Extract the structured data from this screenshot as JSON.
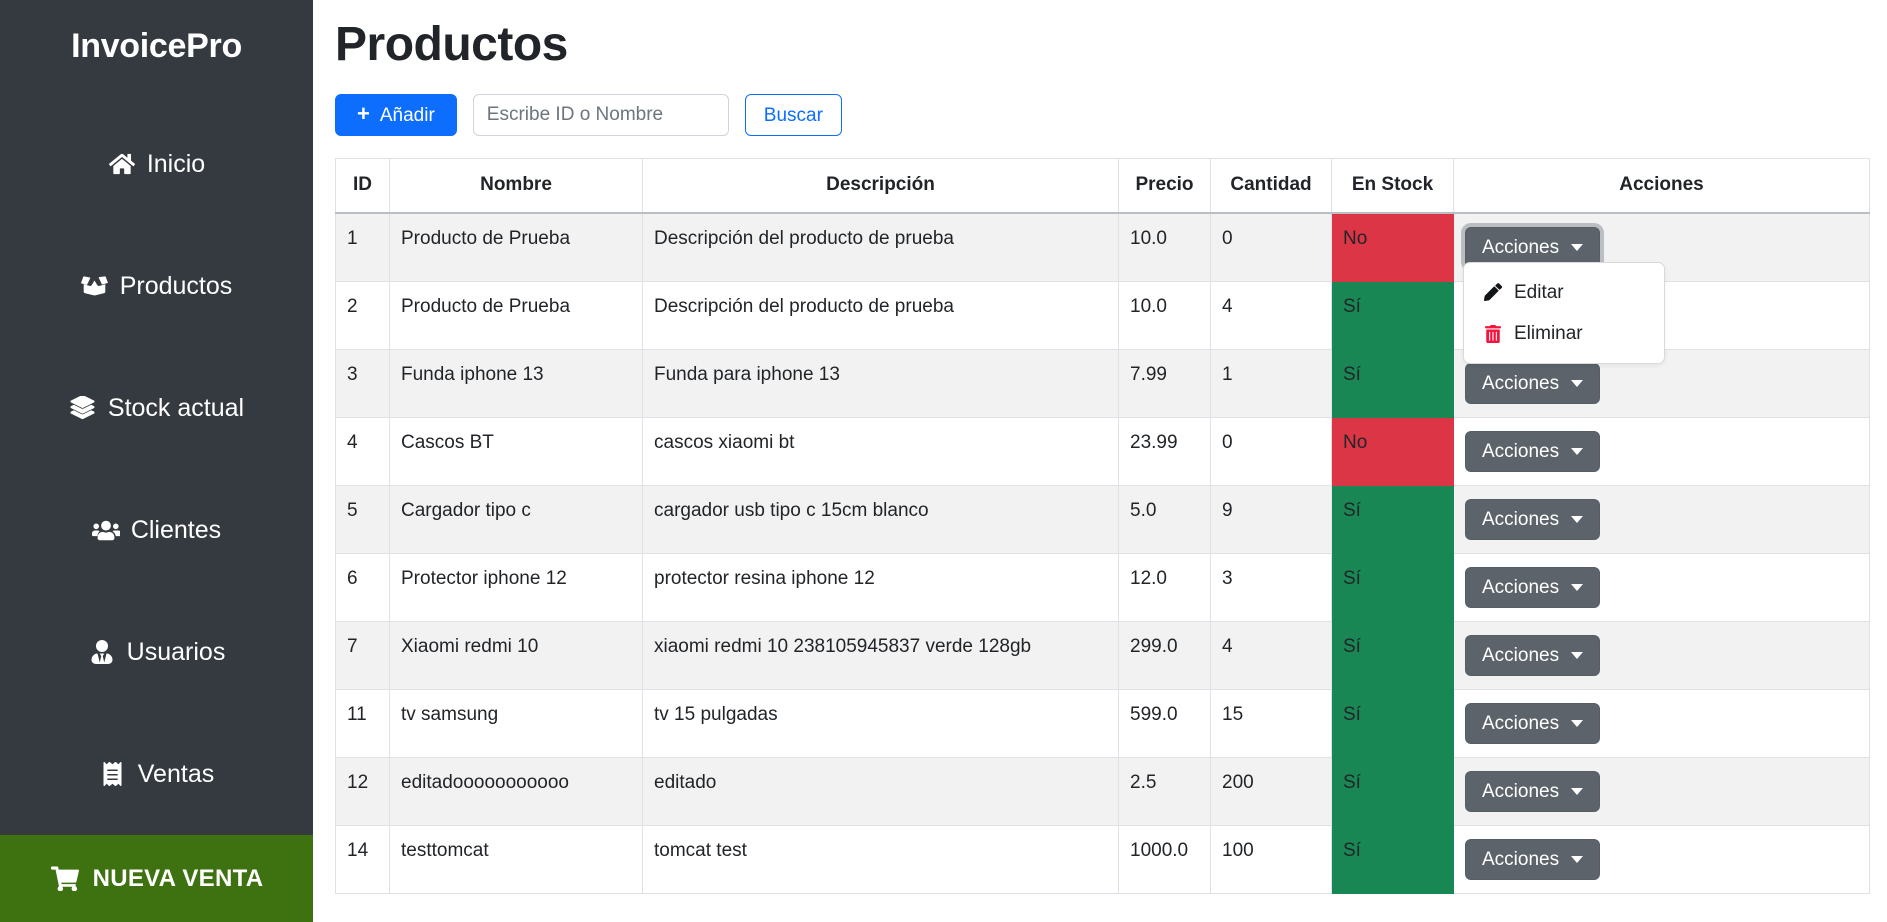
{
  "sidebar": {
    "brand": "InvoicePro",
    "items": [
      {
        "label": "Inicio",
        "icon": "home-icon"
      },
      {
        "label": "Productos",
        "icon": "box-open-icon"
      },
      {
        "label": "Stock actual",
        "icon": "layers-icon"
      },
      {
        "label": "Clientes",
        "icon": "users-icon"
      },
      {
        "label": "Usuarios",
        "icon": "user-tie-icon"
      },
      {
        "label": "Ventas",
        "icon": "receipt-icon"
      }
    ],
    "new_sale": {
      "label": "NUEVA VENTA",
      "icon": "shopping-cart-icon",
      "color": "#3e7110"
    }
  },
  "header": {
    "title": "Productos"
  },
  "toolbar": {
    "add_label": "Añadir",
    "add_icon": "plus-icon",
    "add_color": "#0d6efd",
    "search_placeholder": "Escribe ID o Nombre",
    "search_value": "",
    "search_button_label": "Buscar",
    "search_button_color": "#0d6efd"
  },
  "table": {
    "columns": [
      "ID",
      "Nombre",
      "Descripción",
      "Precio",
      "Cantidad",
      "En Stock",
      "Acciones"
    ],
    "action_button_label": "Acciones",
    "stock_yes_color": "#198754",
    "stock_no_color": "#dc3545",
    "rows": [
      {
        "id": "1",
        "nombre": "Producto de Prueba",
        "descripcion": "Descripción del producto de prueba",
        "precio": "10.0",
        "cantidad": "0",
        "en_stock": "No",
        "in_stock": false
      },
      {
        "id": "2",
        "nombre": "Producto de Prueba",
        "descripcion": "Descripción del producto de prueba",
        "precio": "10.0",
        "cantidad": "4",
        "en_stock": "Sí",
        "in_stock": true
      },
      {
        "id": "3",
        "nombre": "Funda iphone 13",
        "descripcion": "Funda para iphone 13",
        "precio": "7.99",
        "cantidad": "1",
        "en_stock": "Sí",
        "in_stock": true
      },
      {
        "id": "4",
        "nombre": "Cascos BT",
        "descripcion": "cascos xiaomi bt",
        "precio": "23.99",
        "cantidad": "0",
        "en_stock": "No",
        "in_stock": false
      },
      {
        "id": "5",
        "nombre": "Cargador tipo c",
        "descripcion": "cargador usb tipo c 15cm blanco",
        "precio": "5.0",
        "cantidad": "9",
        "en_stock": "Sí",
        "in_stock": true
      },
      {
        "id": "6",
        "nombre": "Protector iphone 12",
        "descripcion": "protector resina iphone 12",
        "precio": "12.0",
        "cantidad": "3",
        "en_stock": "Sí",
        "in_stock": true
      },
      {
        "id": "7",
        "nombre": "Xiaomi redmi 10",
        "descripcion": "xiaomi redmi 10 238105945837 verde 128gb",
        "precio": "299.0",
        "cantidad": "4",
        "en_stock": "Sí",
        "in_stock": true
      },
      {
        "id": "11",
        "nombre": "tv samsung",
        "descripcion": "tv 15 pulgadas",
        "precio": "599.0",
        "cantidad": "15",
        "en_stock": "Sí",
        "in_stock": true
      },
      {
        "id": "12",
        "nombre": "editadooooooooooo",
        "descripcion": "editado",
        "precio": "2.5",
        "cantidad": "200",
        "en_stock": "Sí",
        "in_stock": true
      },
      {
        "id": "14",
        "nombre": "testtomcat",
        "descripcion": "tomcat test",
        "precio": "1000.0",
        "cantidad": "100",
        "en_stock": "Sí",
        "in_stock": true
      }
    ]
  },
  "dropdown": {
    "open_on_row_id": "1",
    "items": [
      {
        "label": "Editar",
        "icon": "pencil-icon",
        "color": "#212529"
      },
      {
        "label": "Eliminar",
        "icon": "trash-icon",
        "color": "#f5143c"
      }
    ]
  }
}
